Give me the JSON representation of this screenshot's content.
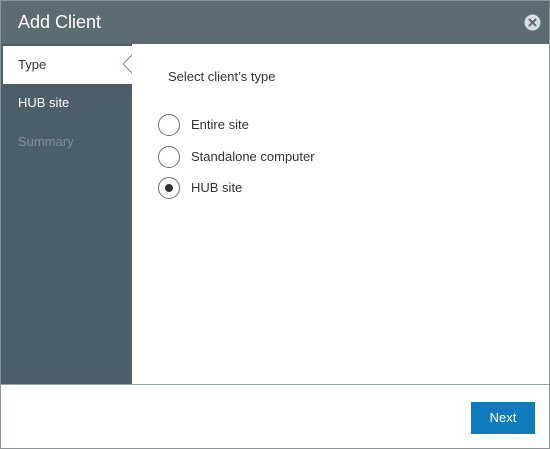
{
  "dialog": {
    "title": "Add Client",
    "close_icon": "close-circle-icon",
    "colors": {
      "titlebar": "#5d6c73",
      "sidebar": "#4c5e67",
      "primary_button": "#0e7bbd"
    }
  },
  "wizard_steps": [
    {
      "label": "Type",
      "state": "active"
    },
    {
      "label": "HUB site",
      "state": "enabled"
    },
    {
      "label": "Summary",
      "state": "disabled"
    }
  ],
  "content": {
    "prompt": "Select client’s type",
    "options": [
      {
        "label": "Entire site",
        "selected": false
      },
      {
        "label": "Standalone computer",
        "selected": false
      },
      {
        "label": "HUB site",
        "selected": true
      }
    ]
  },
  "footer": {
    "next_label": "Next"
  }
}
